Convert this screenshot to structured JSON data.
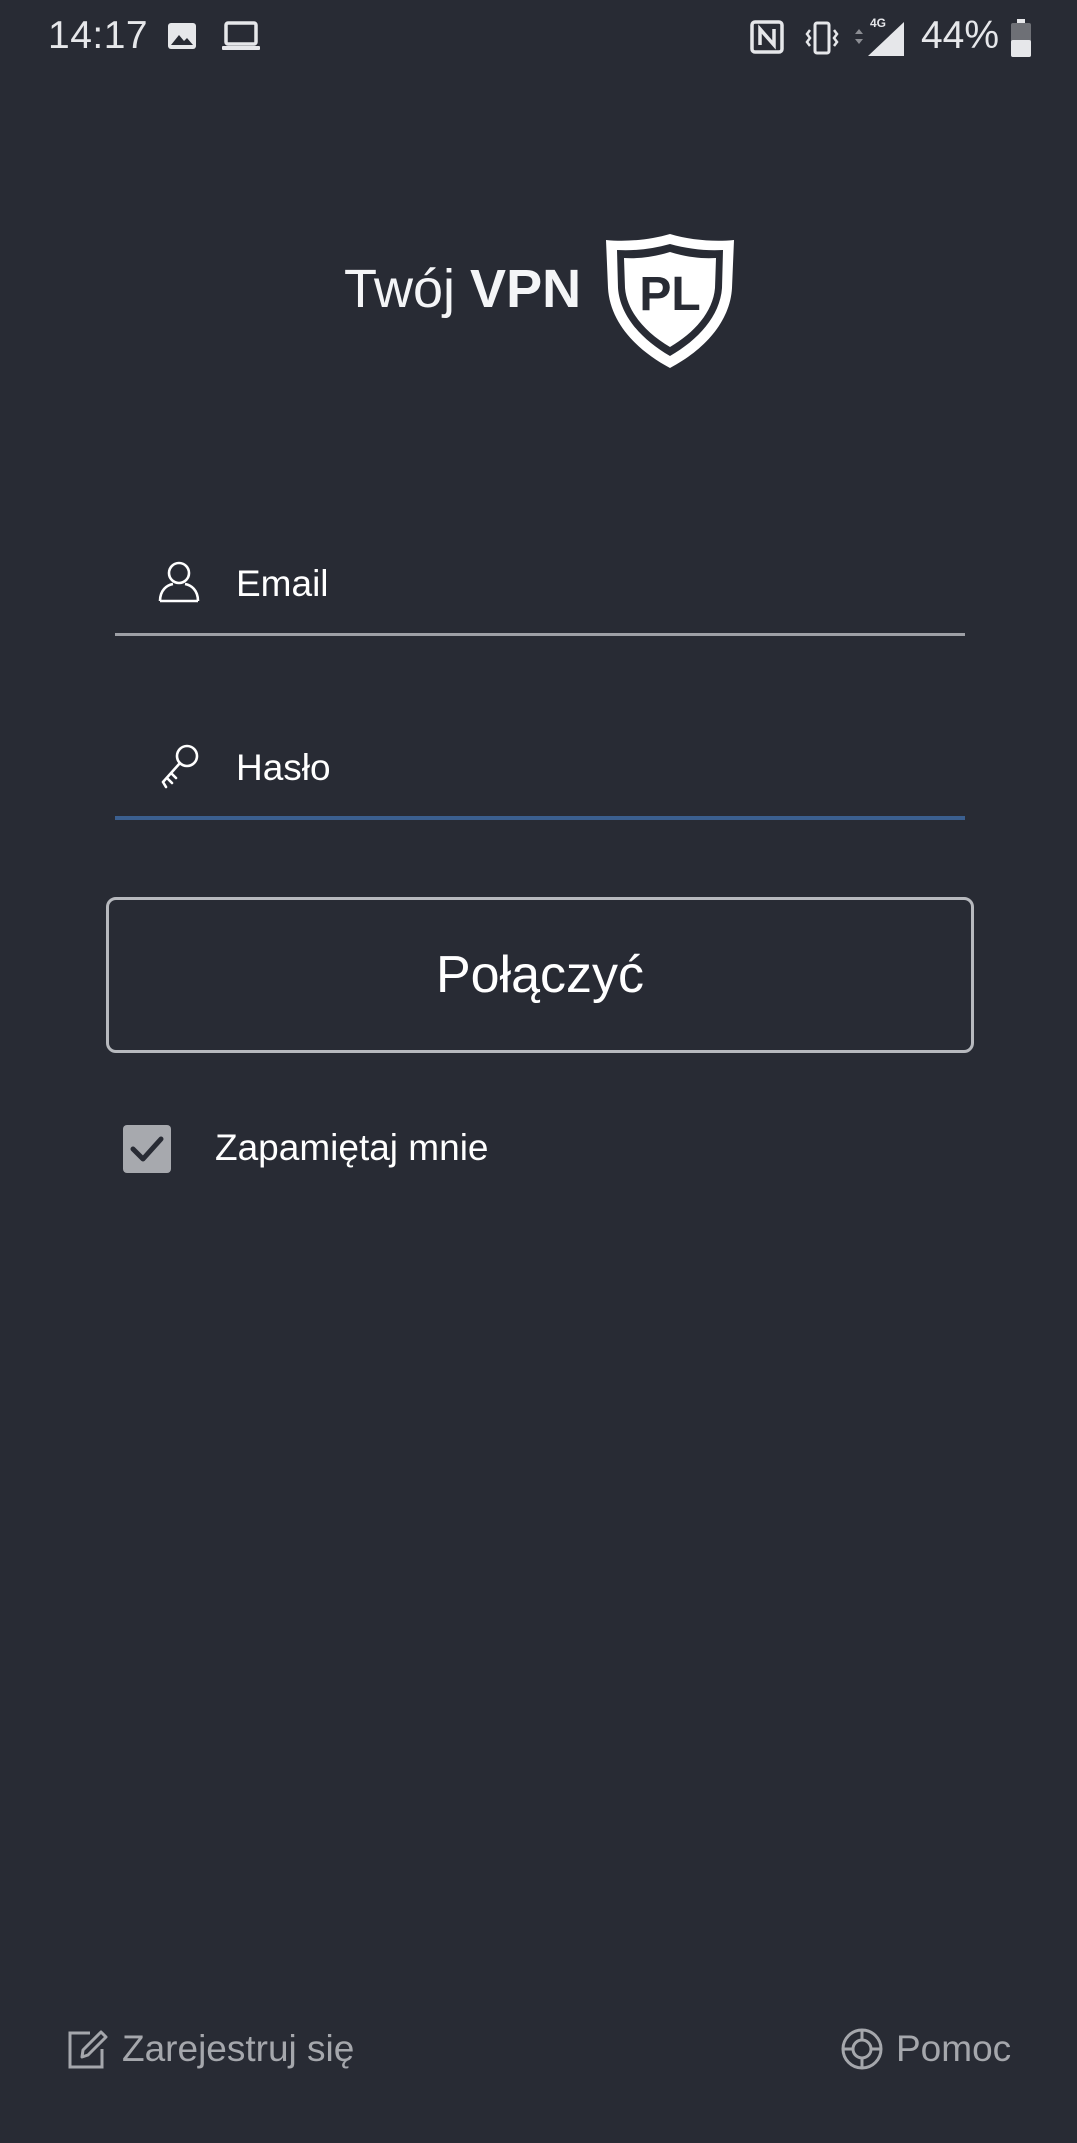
{
  "status_bar": {
    "time": "14:17",
    "battery": "44%",
    "network": "4G",
    "icons": [
      "image-icon",
      "laptop-icon",
      "nfc-icon",
      "vibrate-icon",
      "signal-icon",
      "battery-icon"
    ]
  },
  "logo": {
    "text_light": "Twój ",
    "text_bold": "VPN",
    "badge": "PL"
  },
  "login": {
    "email_placeholder": "Email",
    "email_value": "",
    "password_placeholder": "Hasło",
    "password_value": "",
    "connect_label": "Połączyć",
    "remember_label": "Zapamiętaj mnie",
    "remember_checked": true
  },
  "footer": {
    "register_label": "Zarejestruj się",
    "help_label": "Pomoc"
  },
  "colors": {
    "background": "#282b34",
    "active_underline": "#3b5f8f",
    "muted_text": "#a5a7ac"
  }
}
